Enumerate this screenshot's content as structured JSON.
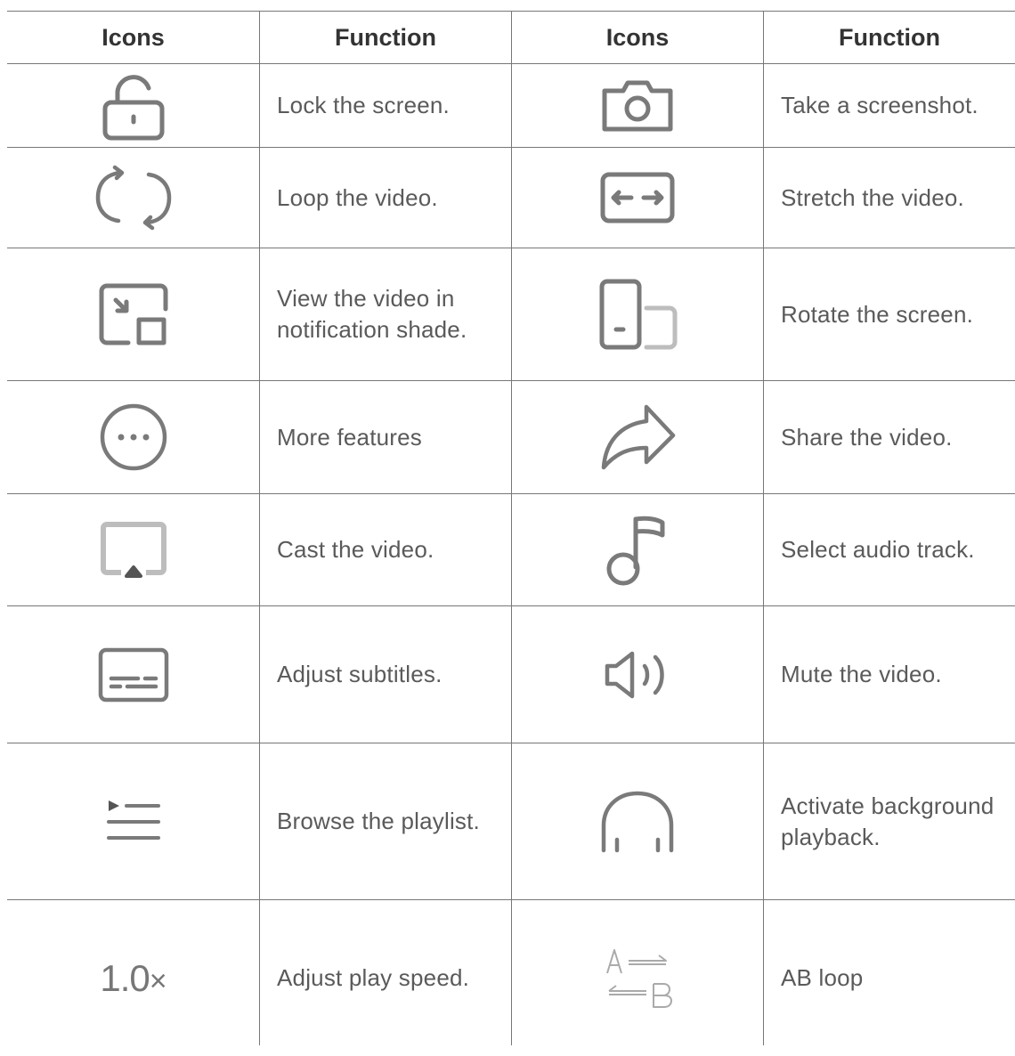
{
  "header": {
    "col1": "Icons",
    "col2": "Function",
    "col3": "Icons",
    "col4": "Function"
  },
  "rows": [
    {
      "left_icon": "unlock-icon",
      "left_text": "Lock the screen.",
      "right_icon": "camera-icon",
      "right_text": "Take a screenshot."
    },
    {
      "left_icon": "loop-icon",
      "left_text": "Loop the video.",
      "right_icon": "stretch-icon",
      "right_text": "Stretch the video."
    },
    {
      "left_icon": "picture-in-picture-icon",
      "left_text": "View the video in\nnotification shade.",
      "right_icon": "rotate-screen-icon",
      "right_text": "Rotate the screen."
    },
    {
      "left_icon": "more-icon",
      "left_text": "More features",
      "right_icon": "share-icon",
      "right_text": "Share the video."
    },
    {
      "left_icon": "cast-icon",
      "left_text": "Cast the video.",
      "right_icon": "music-note-icon",
      "right_text": "Select audio track."
    },
    {
      "left_icon": "subtitles-icon",
      "left_text": "Adjust subtitles.",
      "right_icon": "volume-icon",
      "right_text": "Mute the video."
    },
    {
      "left_icon": "playlist-icon",
      "left_text": "Browse the playlist.",
      "right_icon": "headphones-icon",
      "right_text": "Activate background\nplayback."
    },
    {
      "left_icon": "play-speed-icon",
      "left_speed": "1.0",
      "left_speed_suffix": "×",
      "left_text": "Adjust play speed.",
      "right_icon": "ab-loop-icon",
      "right_text": "AB loop"
    }
  ],
  "colors": {
    "icon": "#7a7a7a",
    "line": "#777777",
    "header_text": "#333333",
    "body_text": "#5a5a5a"
  }
}
